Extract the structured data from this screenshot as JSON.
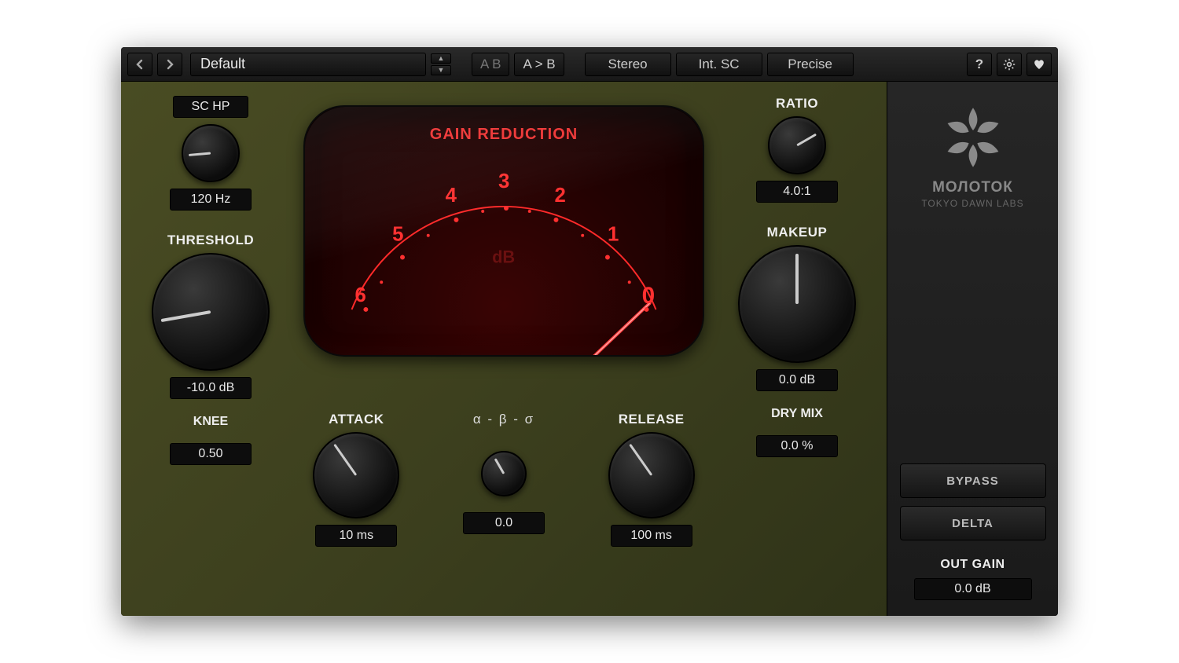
{
  "toolbar": {
    "preset": "Default",
    "ab_label": "A B",
    "copy_ab": "A > B",
    "stereo": "Stereo",
    "sidechain": "Int. SC",
    "quality": "Precise"
  },
  "meter": {
    "title": "GAIN REDUCTION",
    "unit": "dB",
    "scale": [
      "6",
      "5",
      "4",
      "3",
      "2",
      "1",
      "0"
    ]
  },
  "knobs": {
    "schp": {
      "label": "SC HP",
      "value": "120 Hz",
      "angle": -95
    },
    "threshold": {
      "label": "THRESHOLD",
      "value": "-10.0 dB",
      "angle": -100
    },
    "knee": {
      "label": "KNEE",
      "value": "0.50"
    },
    "attack": {
      "label": "ATTACK",
      "value": "10 ms",
      "angle": -35
    },
    "release": {
      "label": "RELEASE",
      "value": "100 ms",
      "angle": -35
    },
    "mode": {
      "label": "α - β - σ",
      "value": "0.0",
      "angle": -30
    },
    "ratio": {
      "label": "RATIO",
      "value": "4.0:1",
      "angle": 60
    },
    "makeup": {
      "label": "MAKEUP",
      "value": "0.0 dB",
      "angle": 0
    },
    "drymix": {
      "label": "DRY MIX",
      "value": "0.0 %"
    }
  },
  "right": {
    "brand": "МОЛОТОК",
    "brand_sub": "TOKYO DAWN LABS",
    "bypass": "BYPASS",
    "delta": "DELTA",
    "outgain_label": "OUT GAIN",
    "outgain_value": "0.0 dB"
  }
}
